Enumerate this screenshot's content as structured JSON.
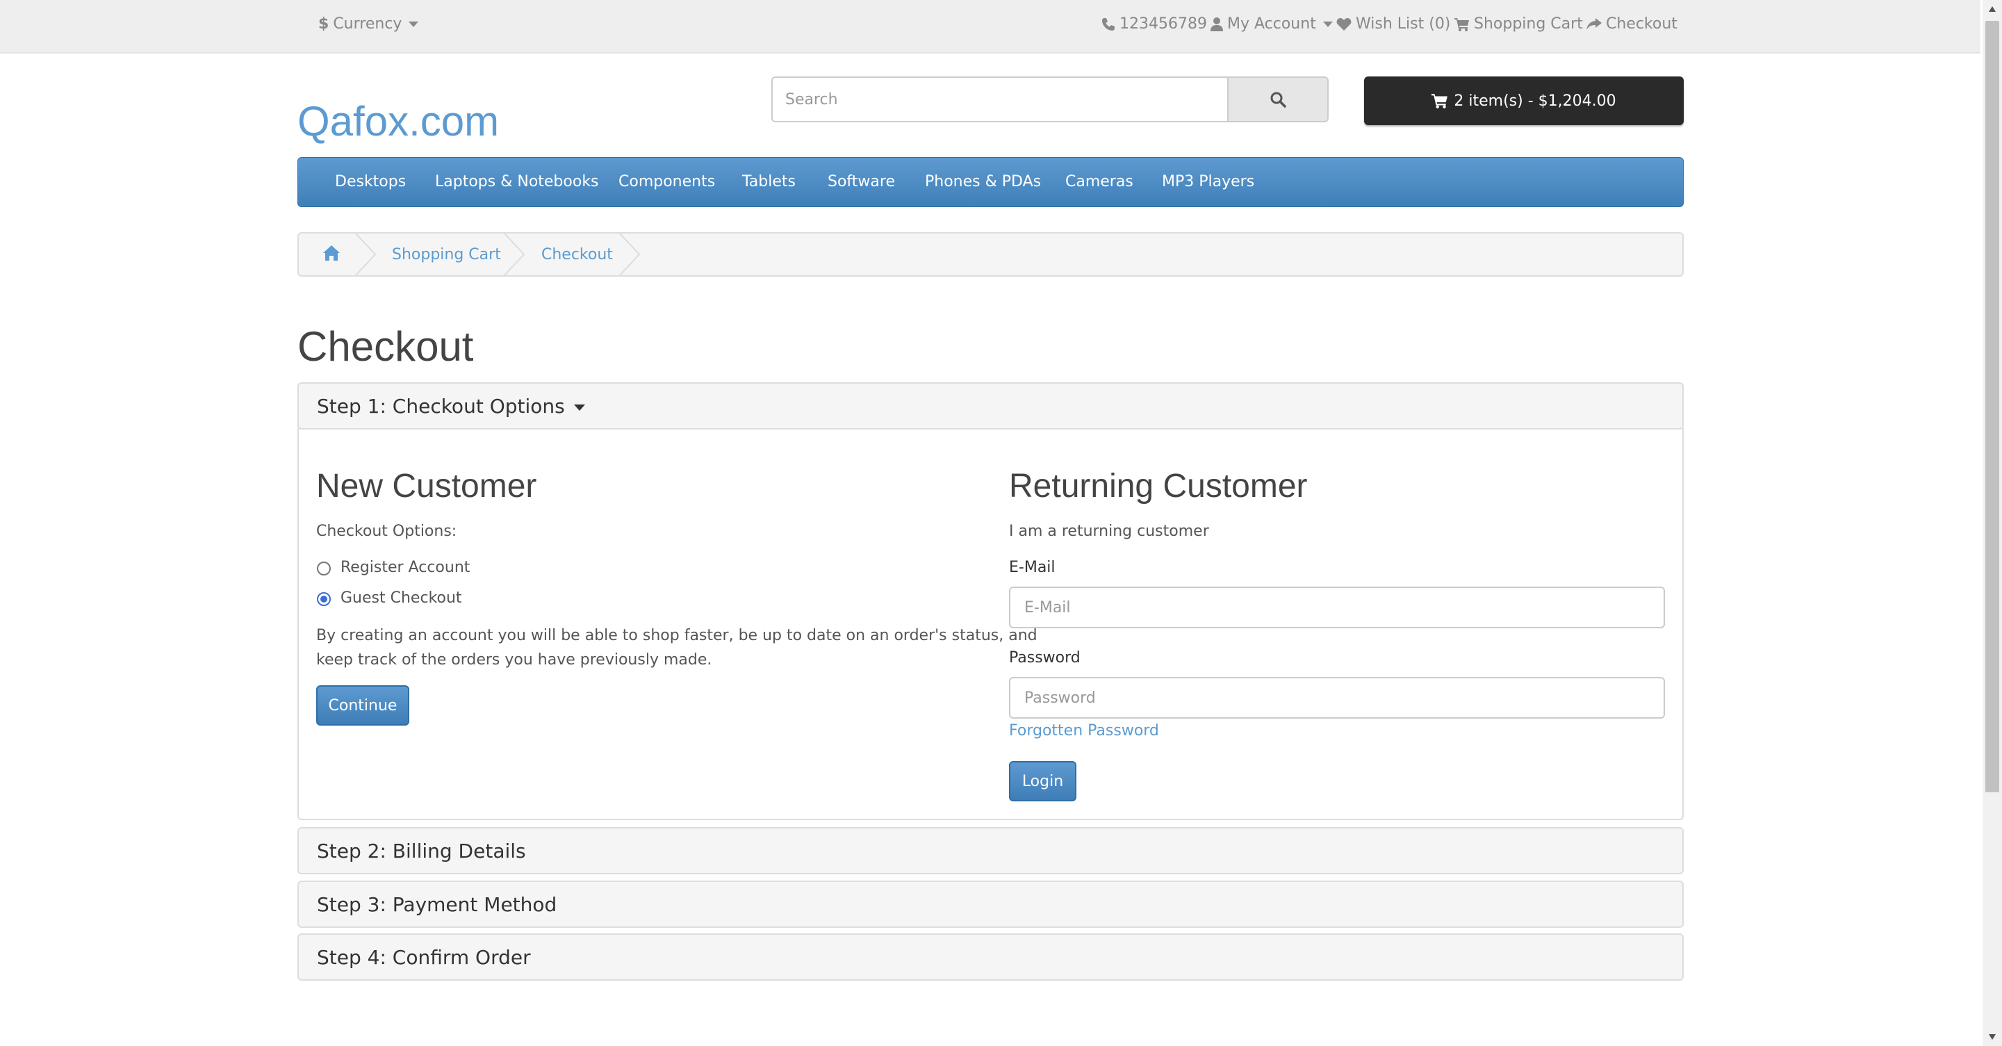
{
  "topbar": {
    "currency": "Currency",
    "phone": "123456789",
    "my_account": "My Account",
    "wishlist": "Wish List (0)",
    "shopping_cart": "Shopping Cart",
    "checkout": "Checkout"
  },
  "header": {
    "logo": "Qafox.com",
    "search_placeholder": "Search",
    "cart_button": "2 item(s) - $1,204.00"
  },
  "nav": {
    "items": [
      "Desktops",
      "Laptops & Notebooks",
      "Components",
      "Tablets",
      "Software",
      "Phones & PDAs",
      "Cameras",
      "MP3 Players"
    ]
  },
  "breadcrumb": {
    "items": [
      "Shopping Cart",
      "Checkout"
    ]
  },
  "page": {
    "title": "Checkout"
  },
  "steps": {
    "step1": "Step 1: Checkout Options",
    "step2": "Step 2: Billing Details",
    "step3": "Step 3: Payment Method",
    "step4": "Step 4: Confirm Order"
  },
  "new_customer": {
    "title": "New Customer",
    "options_label": "Checkout Options:",
    "register": "Register Account",
    "guest": "Guest Checkout",
    "description_line1": "By creating an account you will be able to shop faster, be up to date on an order's status, and",
    "description_line2": "keep track of the orders you have previously made.",
    "continue": "Continue"
  },
  "returning_customer": {
    "title": "Returning Customer",
    "subtitle": "I am a returning customer",
    "email_label": "E-Mail",
    "email_placeholder": "E-Mail",
    "password_label": "Password",
    "password_placeholder": "Password",
    "forgotten": "Forgotten Password",
    "login": "Login"
  }
}
